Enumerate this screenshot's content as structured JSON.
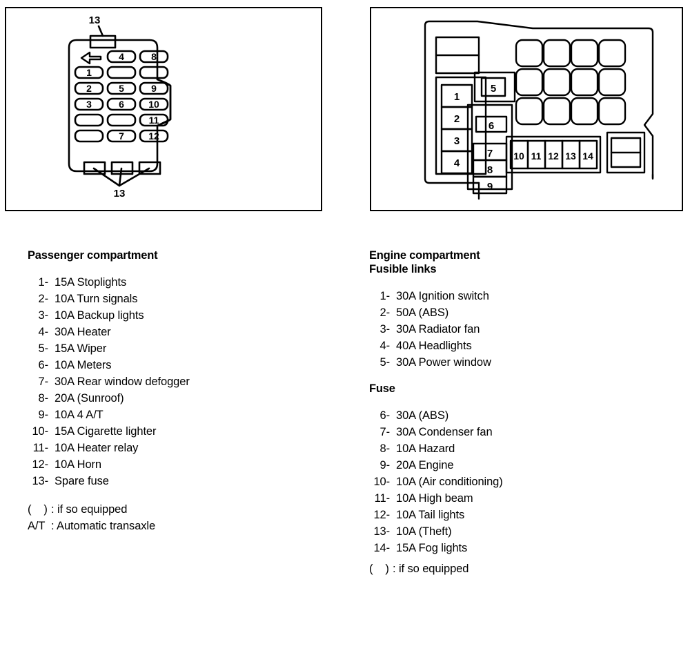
{
  "diagram": {
    "title_hidden": "Automotive fuse box identification diagram",
    "passenger_box": {
      "callout_top": "13",
      "callout_bottom": "13",
      "arrow_icon": "left-arrow",
      "grid": [
        [
          "arrow",
          "4",
          "8"
        ],
        [
          "1",
          "",
          ""
        ],
        [
          "2",
          "5",
          "9"
        ],
        [
          "3",
          "6",
          "10"
        ],
        [
          "",
          "",
          "11"
        ],
        [
          "",
          "7",
          "12"
        ]
      ],
      "top_tabs": 1,
      "bottom_tabs": 3
    },
    "engine_box": {
      "left_column": [
        "1",
        "2",
        "3",
        "4"
      ],
      "center_top": "5",
      "center_mid": "6",
      "center_stack": [
        "7",
        "8",
        "9"
      ],
      "fuse_strip": [
        "10",
        "11",
        "12",
        "13",
        "14"
      ],
      "relay_grid_rows": 3,
      "relay_grid_cols": 4,
      "blank_blocks": 2
    }
  },
  "passenger": {
    "heading": "Passenger compartment",
    "items": [
      {
        "num": "1-",
        "text": "15A Stoplights"
      },
      {
        "num": "2-",
        "text": "10A Turn signals"
      },
      {
        "num": "3-",
        "text": "10A Backup lights"
      },
      {
        "num": "4-",
        "text": "30A Heater"
      },
      {
        "num": "5-",
        "text": "15A Wiper"
      },
      {
        "num": "6-",
        "text": "10A Meters"
      },
      {
        "num": "7-",
        "text": "30A Rear window defogger"
      },
      {
        "num": "8-",
        "text": "20A (Sunroof)"
      },
      {
        "num": "9-",
        "text": "10A 4 A/T"
      },
      {
        "num": "10-",
        "text": "15A Cigarette lighter"
      },
      {
        "num": "11-",
        "text": "10A Heater relay"
      },
      {
        "num": "12-",
        "text": "10A Horn"
      },
      {
        "num": "13-",
        "text": "Spare fuse"
      }
    ],
    "notes": [
      {
        "key": "(    )",
        "value": ": if so equipped"
      },
      {
        "key": "A/T ",
        "value": ": Automatic transaxle"
      }
    ]
  },
  "engine": {
    "heading_line1": "Engine compartment",
    "heading_line2": "Fusible links",
    "fusible_links": [
      {
        "num": "1-",
        "text": "30A Ignition switch"
      },
      {
        "num": "2-",
        "text": "50A (ABS)"
      },
      {
        "num": "3-",
        "text": "30A Radiator fan"
      },
      {
        "num": "4-",
        "text": "40A Headlights"
      },
      {
        "num": "5-",
        "text": "30A Power window"
      }
    ],
    "fuse_heading": "Fuse",
    "fuses": [
      {
        "num": "6-",
        "text": "30A (ABS)"
      },
      {
        "num": "7-",
        "text": "30A Condenser fan"
      },
      {
        "num": "8-",
        "text": "10A Hazard"
      },
      {
        "num": "9-",
        "text": "20A Engine"
      },
      {
        "num": "10-",
        "text": "10A (Air conditioning)"
      },
      {
        "num": "11-",
        "text": "10A High beam"
      },
      {
        "num": "12-",
        "text": "10A Tail lights"
      },
      {
        "num": "13-",
        "text": "10A (Theft)"
      },
      {
        "num": "14-",
        "text": "15A Fog lights"
      }
    ],
    "notes": [
      {
        "key": "(    )",
        "value": ": if so equipped"
      }
    ]
  },
  "colors": {
    "ink": "#000000",
    "paper": "#ffffff"
  }
}
